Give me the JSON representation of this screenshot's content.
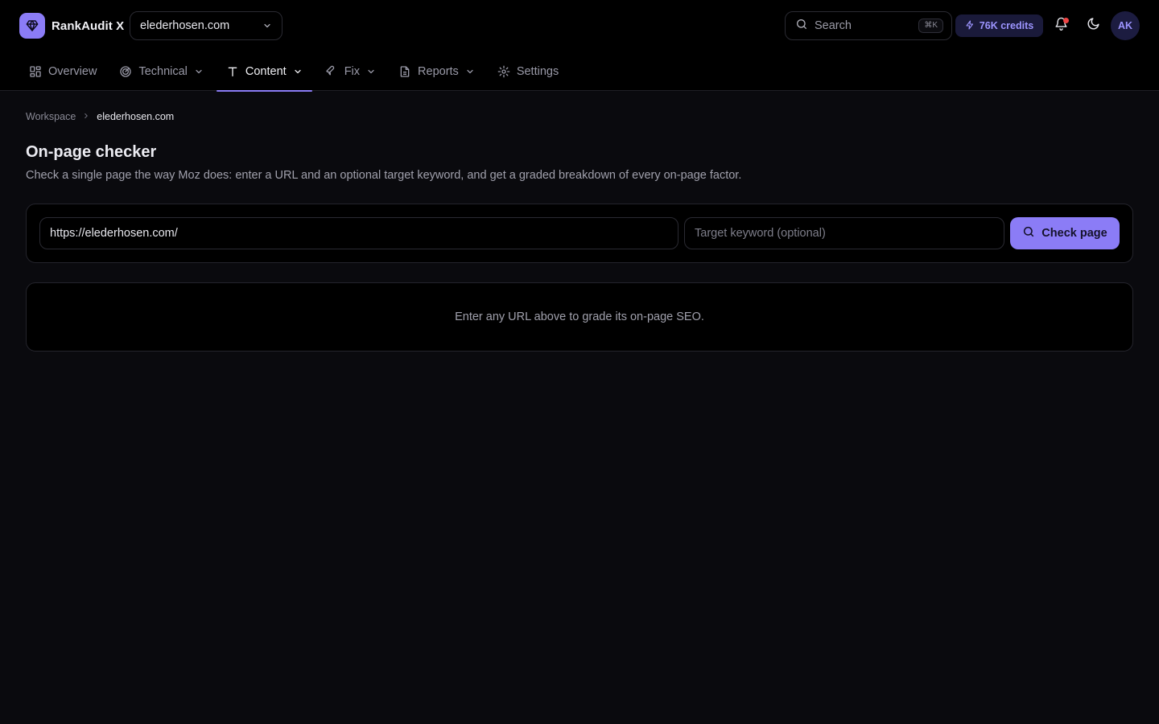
{
  "app": {
    "name": "RankAudit X",
    "site_selector": "elederhosen.com"
  },
  "header": {
    "search_placeholder": "Search",
    "search_shortcut": "⌘K",
    "credits": "76K credits",
    "avatar_initials": "AK"
  },
  "nav": {
    "items": [
      {
        "label": "Overview",
        "icon": "grid-icon",
        "dropdown": false
      },
      {
        "label": "Technical",
        "icon": "radar-icon",
        "dropdown": true
      },
      {
        "label": "Content",
        "icon": "text-icon",
        "dropdown": true,
        "active": true
      },
      {
        "label": "Fix",
        "icon": "wrench-icon",
        "dropdown": true
      },
      {
        "label": "Reports",
        "icon": "file-icon",
        "dropdown": true
      },
      {
        "label": "Settings",
        "icon": "gear-icon",
        "dropdown": false
      }
    ]
  },
  "breadcrumb": {
    "root": "Workspace",
    "current": "elederhosen.com"
  },
  "page": {
    "title": "On-page checker",
    "description": "Check a single page the way Moz does: enter a URL and an optional target keyword, and get a graded breakdown of every on-page factor."
  },
  "form": {
    "url_value": "https://elederhosen.com/",
    "keyword_placeholder": "Target keyword (optional)",
    "submit_label": "Check page"
  },
  "empty_state": {
    "message": "Enter any URL above to grade its on-page SEO."
  },
  "colors": {
    "accent": "#8b7cf6",
    "background": "#0a0a0e",
    "header_background": "#000000",
    "notification_dot": "#ef4444"
  }
}
